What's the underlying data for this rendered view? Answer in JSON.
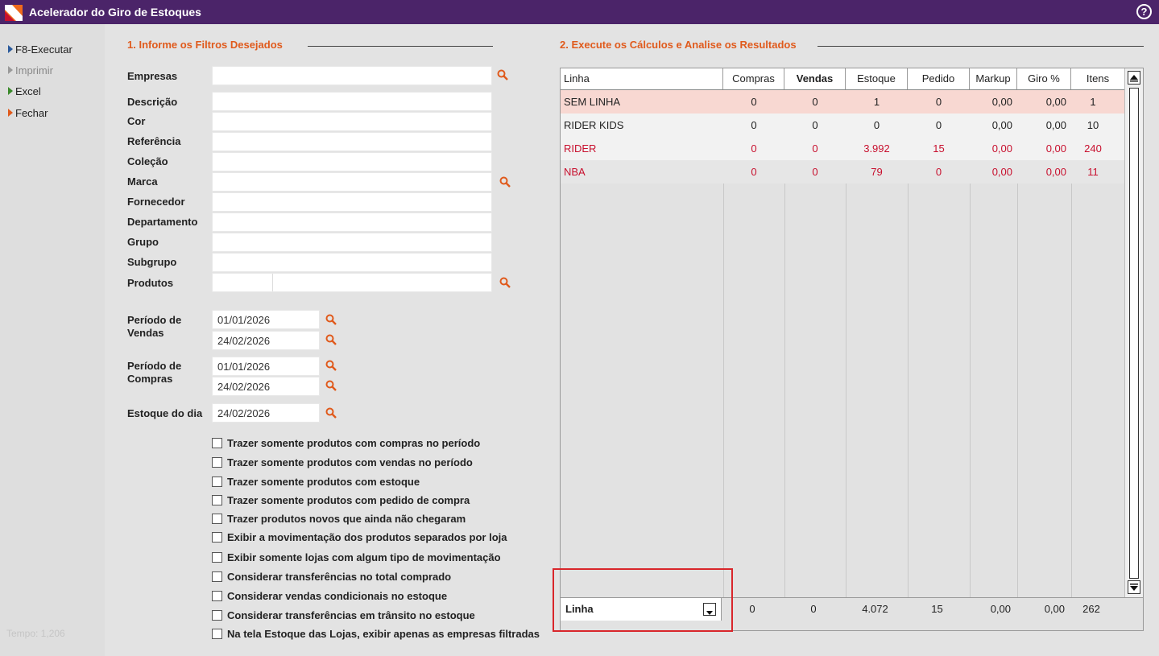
{
  "window": {
    "title": "Acelerador do Giro de Estoques",
    "help_icon": "help-circle-icon"
  },
  "sidebar": {
    "items": [
      {
        "label": "F8-Executar",
        "state": "enabled",
        "color": "#2a5a9c"
      },
      {
        "label": "Imprimir",
        "state": "disabled",
        "color": "#999999"
      },
      {
        "label": "Excel",
        "state": "enabled",
        "color": "#3a8a2a"
      },
      {
        "label": "Fechar",
        "state": "enabled",
        "color": "#e05a1c"
      }
    ],
    "tempo": "Tempo:  1,206"
  },
  "filters": {
    "section_title": "1. Informe os Filtros Desejados",
    "fields": [
      {
        "label": "Empresas",
        "value": ""
      },
      {
        "label": "Descrição",
        "value": ""
      },
      {
        "label": "Cor",
        "value": ""
      },
      {
        "label": "Referência",
        "value": ""
      },
      {
        "label": "Coleção",
        "value": ""
      },
      {
        "label": "Marca",
        "value": ""
      },
      {
        "label": "Fornecedor",
        "value": ""
      },
      {
        "label": "Departamento",
        "value": ""
      },
      {
        "label": "Grupo",
        "value": ""
      },
      {
        "label": "Subgrupo",
        "value": ""
      },
      {
        "label": "Produtos",
        "value": ""
      }
    ],
    "periodo_vendas": {
      "label_line1": "Período de",
      "label_line2": "Vendas",
      "from": "01/01/2026",
      "to": "24/02/2026"
    },
    "periodo_compras": {
      "label_line1": "Período de",
      "label_line2": "Compras",
      "from": "01/01/2026",
      "to": "24/02/2026"
    },
    "estoque_dia": {
      "label": "Estoque do dia",
      "value": "24/02/2026"
    },
    "checkboxes": [
      {
        "label": "Trazer somente produtos com compras no período",
        "checked": false
      },
      {
        "label": "Trazer somente produtos com vendas no período",
        "checked": false
      },
      {
        "label": "Trazer somente produtos com estoque",
        "checked": false
      },
      {
        "label": "Trazer somente produtos com pedido de compra",
        "checked": false
      },
      {
        "label": "Trazer produtos novos que ainda não chegaram",
        "checked": false
      },
      {
        "label": "Exibir a movimentação dos produtos separados por loja",
        "checked": false
      },
      {
        "label": "Exibir somente lojas com algum tipo de movimentação",
        "checked": false
      },
      {
        "label": "Considerar transferências no total comprado",
        "checked": false
      },
      {
        "label": "Considerar vendas condicionais no estoque",
        "checked": false
      },
      {
        "label": "Considerar transferências em trânsito no estoque",
        "checked": false
      },
      {
        "label": "Na tela Estoque das Lojas, exibir apenas as empresas filtradas",
        "checked": false
      }
    ]
  },
  "results": {
    "section_title": "2. Execute os Cálculos e Analise os Resultados",
    "columns": [
      "Linha",
      "Compras",
      "Vendas",
      "Estoque",
      "Pedido",
      "Markup",
      "Giro %",
      "Itens"
    ],
    "rows": [
      {
        "cells": [
          "SEM LINHA",
          "0",
          "0",
          "1",
          "0",
          "0,00",
          "0,00",
          "1"
        ],
        "color": "#222222",
        "bg": "#f8d8d2"
      },
      {
        "cells": [
          "RIDER KIDS",
          "0",
          "0",
          "0",
          "0",
          "0,00",
          "0,00",
          "10"
        ],
        "color": "#222222",
        "bg": "#f2f2f2"
      },
      {
        "cells": [
          "RIDER",
          "0",
          "0",
          "3.992",
          "15",
          "0,00",
          "0,00",
          "240"
        ],
        "color": "#c8102e",
        "bg": "#f2f2f2"
      },
      {
        "cells": [
          "NBA",
          "0",
          "0",
          "79",
          "0",
          "0,00",
          "0,00",
          "11"
        ],
        "color": "#c8102e",
        "bg": "#e6e6e6"
      }
    ],
    "footer": {
      "group_by": "Linha",
      "totals": [
        "0",
        "0",
        "4.072",
        "15",
        "0,00",
        "0,00",
        "262"
      ]
    }
  }
}
